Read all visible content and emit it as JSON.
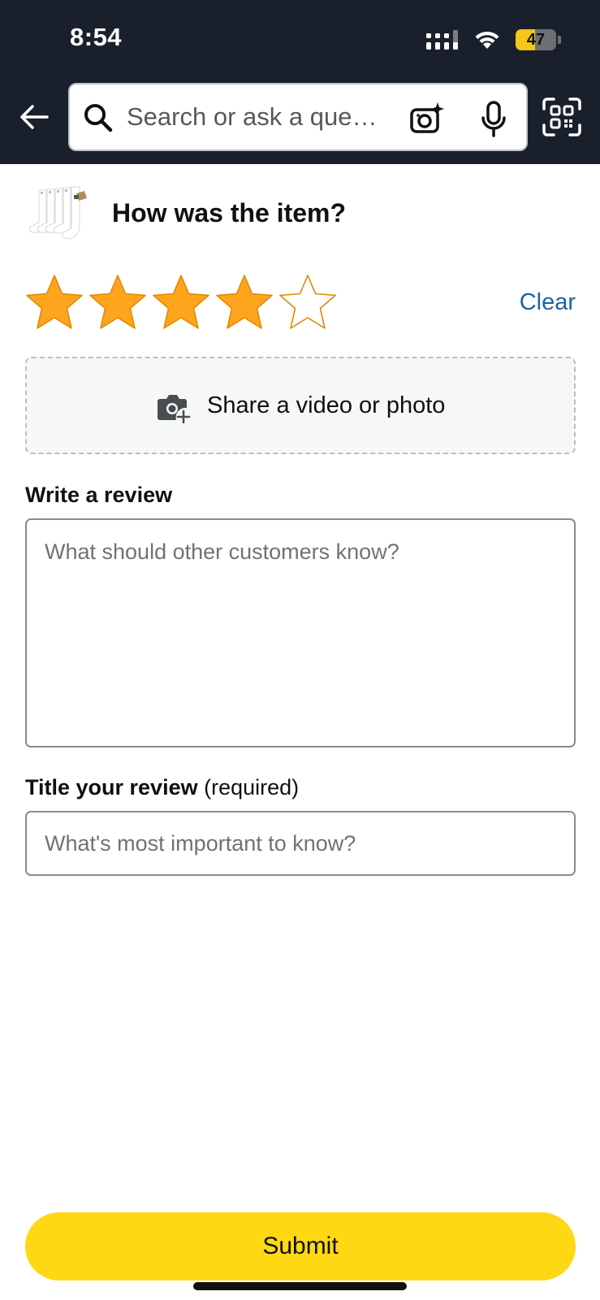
{
  "status_bar": {
    "time": "8:54",
    "battery_level": "47",
    "battery_fraction": 0.47
  },
  "header": {
    "search_placeholder": "Search or ask a que…",
    "icons": [
      "back-arrow-icon",
      "search-icon",
      "camera-ai-icon",
      "microphone-icon",
      "scan-icon"
    ]
  },
  "review": {
    "question": "How was the item?",
    "rating": 4,
    "max_rating": 5,
    "clear_label": "Clear",
    "upload_label": "Share a video or photo",
    "write_heading": "Write a review",
    "write_placeholder": "What should other customers know?",
    "title_heading": "Title your review",
    "title_suffix": "(required)",
    "title_placeholder": "What's most important to know?",
    "submit_label": "Submit"
  },
  "colors": {
    "header_bg": "#19202b",
    "star_fill": "#ffa41c",
    "link": "#2162a1",
    "submit_bg": "#ffd814",
    "battery_fill": "#f5c518"
  }
}
